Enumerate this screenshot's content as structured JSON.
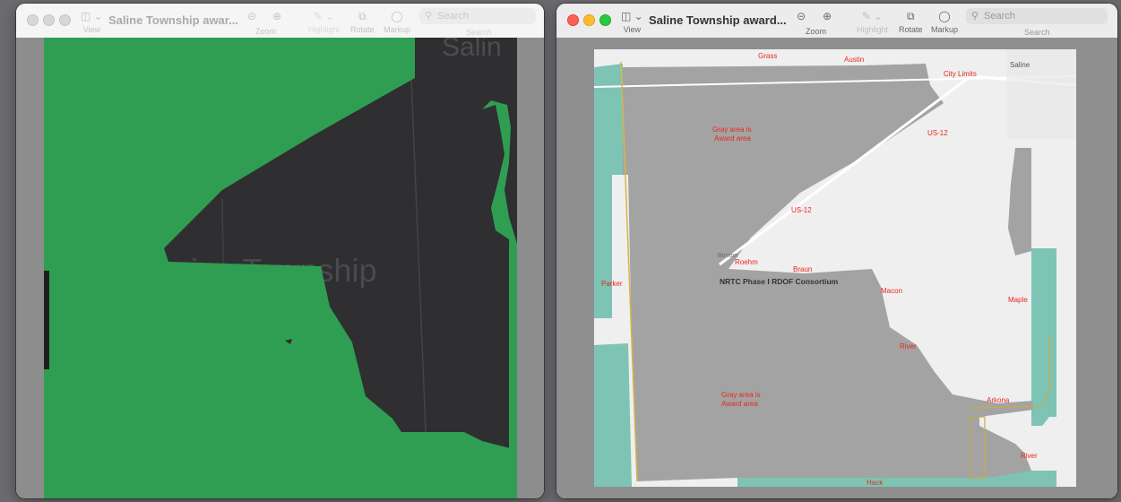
{
  "windows": [
    {
      "id": "left",
      "title": "Saline Township awar...",
      "toolbar": {
        "view": "View",
        "zoom": "Zoom",
        "highlight": "Highlight",
        "rotate": "Rotate",
        "markup": "Markup",
        "search_placeholder": "Search",
        "search_label": "Search"
      },
      "map_text": {
        "town_partial": "Salin",
        "township_partial": "ine Township"
      },
      "colors": {
        "dark": "#2f2e30",
        "green": "#2f9e52"
      }
    },
    {
      "id": "right",
      "title": "Saline Township award...",
      "toolbar": {
        "view": "View",
        "zoom": "Zoom",
        "highlight": "Highlight",
        "rotate": "Rotate",
        "markup": "Markup",
        "search_placeholder": "Search",
        "search_label": "Search"
      },
      "map": {
        "labels": {
          "grass": "Grass",
          "austin": "Austin",
          "saline": "Saline",
          "city_limits": "City Limits",
          "gray_area_1": [
            "Gray area is",
            "Award area"
          ],
          "us12_a": "US-12",
          "us12_b": "US-12",
          "benton": "Benton",
          "roehm": "Roehm",
          "braun": "Braun",
          "parker": "Parker",
          "consortium": "NRTC Phase I RDOF Consortium",
          "macon": "Macon",
          "maple": "Maple",
          "river_1": "River",
          "gray_area_2": [
            "Gray area is",
            "Award area"
          ],
          "arkona": "Arkona",
          "river_2": "River",
          "hack": "Hack"
        },
        "colors": {
          "award_gray": "#a3a3a3",
          "teal": "#7dc4b4",
          "label_red": "#e8281f",
          "road": "#ffffff",
          "base": "#efefef"
        }
      }
    }
  ]
}
